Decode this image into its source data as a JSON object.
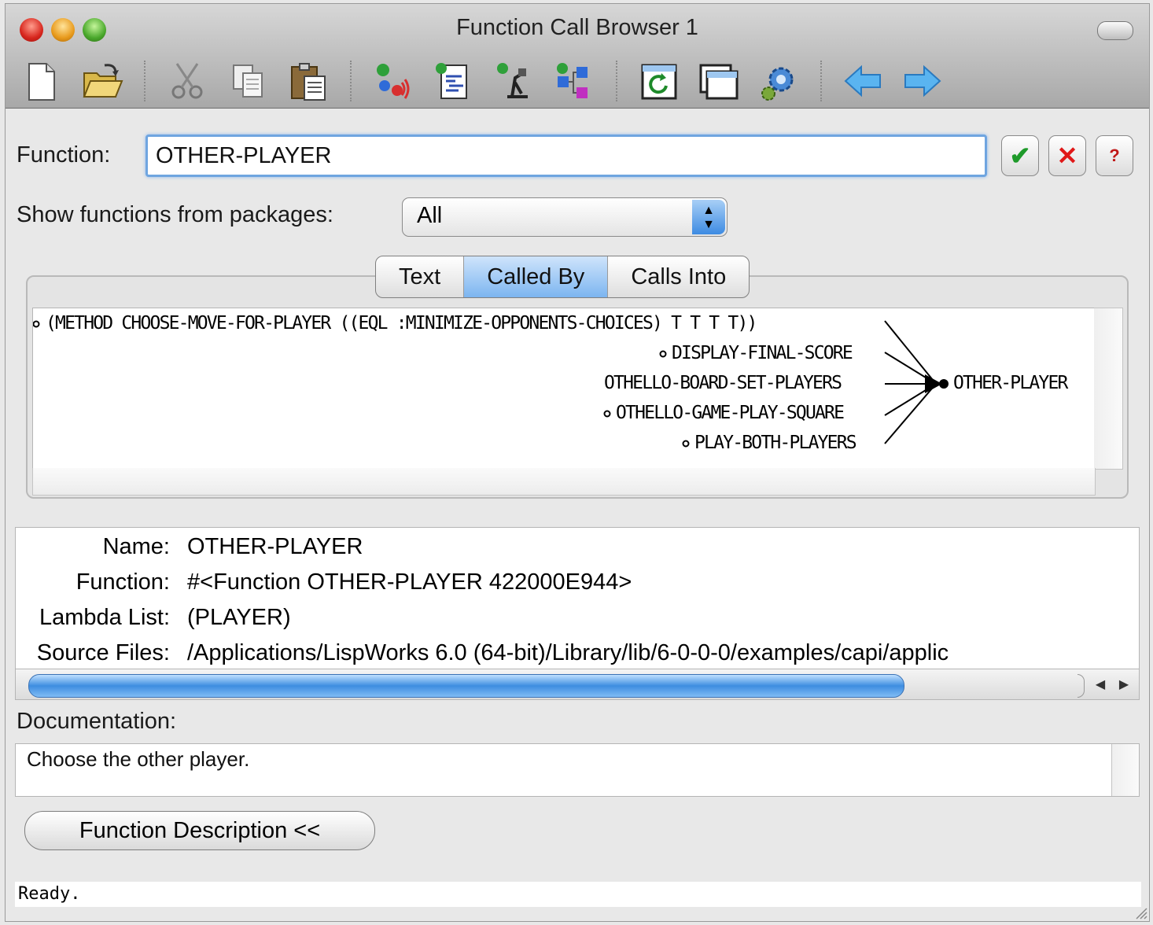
{
  "window": {
    "title": "Function Call Browser 1"
  },
  "toolbar": {
    "buttons": [
      "new-file",
      "open-file",
      "cut",
      "copy",
      "paste",
      "callers",
      "edit-source",
      "inspect",
      "browse-class",
      "refresh",
      "new-window",
      "preferences",
      "back",
      "forward"
    ]
  },
  "function_field": {
    "label": "Function:",
    "value": "OTHER-PLAYER"
  },
  "packages": {
    "label": "Show functions from packages:",
    "selected": "All"
  },
  "tabs": [
    "Text",
    "Called By",
    "Calls Into"
  ],
  "active_tab": "Called By",
  "graph": {
    "callers": [
      "(METHOD CHOOSE-MOVE-FOR-PLAYER ((EQL :MINIMIZE-OPPONENTS-CHOICES) T T T T))",
      "DISPLAY-FINAL-SCORE",
      "OTHELLO-BOARD-SET-PLAYERS",
      "OTHELLO-GAME-PLAY-SQUARE",
      "PLAY-BOTH-PLAYERS"
    ],
    "target": "OTHER-PLAYER"
  },
  "info": {
    "name_label": "Name:",
    "name": "OTHER-PLAYER",
    "function_label": "Function:",
    "function": "#<Function OTHER-PLAYER 422000E944>",
    "lambda_label": "Lambda List:",
    "lambda": "(PLAYER)",
    "source_label": "Source Files:",
    "source": "/Applications/LispWorks 6.0 (64-bit)/Library/lib/6-0-0-0/examples/capi/applic"
  },
  "documentation": {
    "label": "Documentation:",
    "text": "Choose the other player."
  },
  "description_button": "Function Description <<",
  "status": "Ready."
}
